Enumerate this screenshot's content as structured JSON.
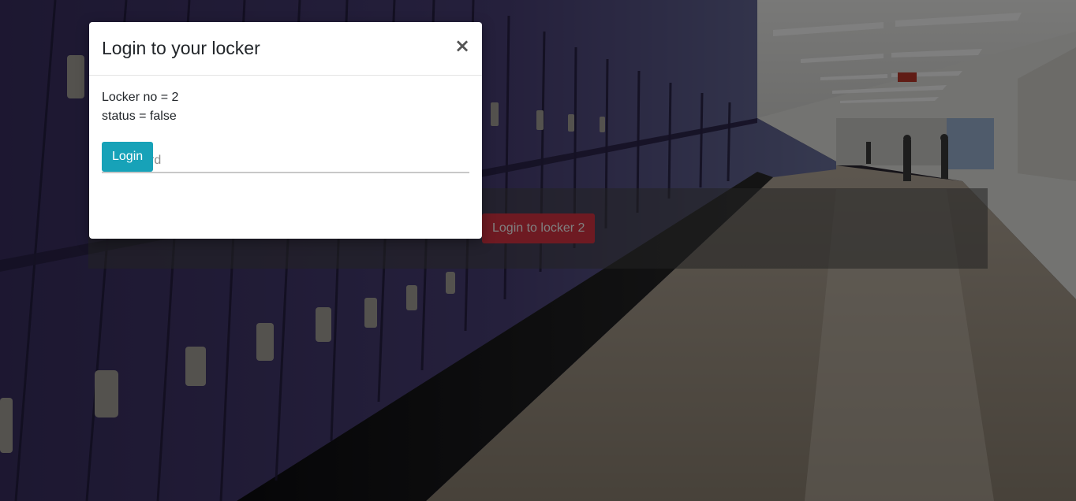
{
  "background": {
    "description_icon": "school-hallway-lockers-image"
  },
  "page": {
    "locker_button_label": "Login to locker 2"
  },
  "modal": {
    "title": "Login to your locker",
    "close_label": "×",
    "locker_line": "Locker no = 2",
    "status_line": "status = false",
    "password_placeholder": "Password",
    "password_value": "",
    "login_label": "Login"
  },
  "colors": {
    "primary_login": "#17a2b8",
    "danger_locker": "#dc3545",
    "locker_purple": "#3b3160"
  }
}
